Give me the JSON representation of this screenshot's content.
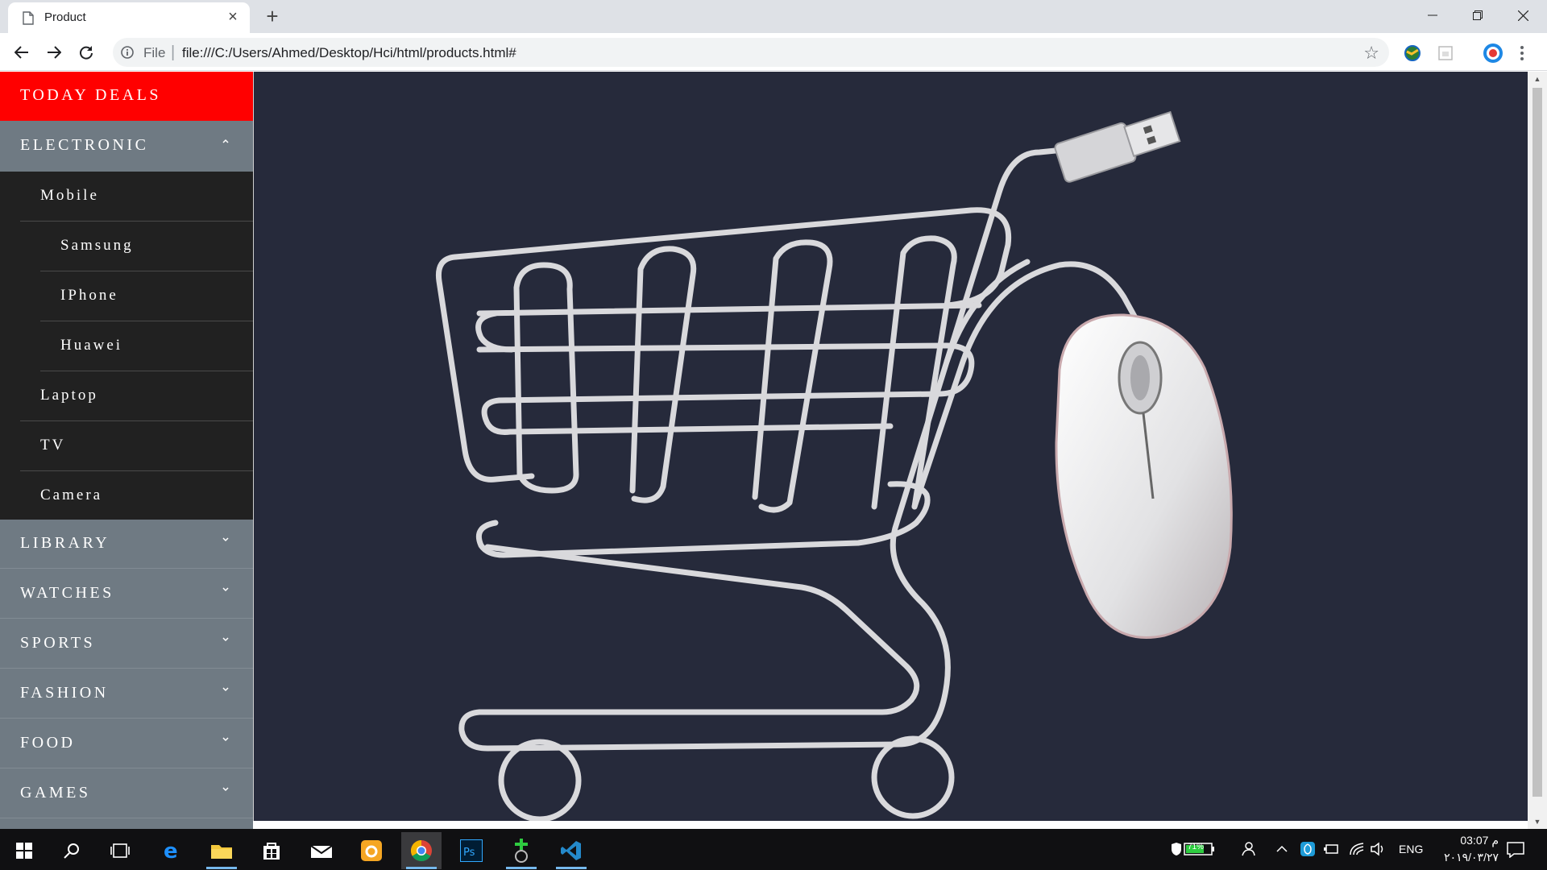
{
  "browser": {
    "tab_title": "Product",
    "scheme": "File",
    "url": "file:///C:/Users/Ahmed/Desktop/Hci/html/products.html#"
  },
  "sidebar": {
    "deals": "TODAY DEALS",
    "electronic": "ELECTRONIC",
    "sub": {
      "mobile": "Mobile",
      "samsung": "Samsung",
      "iphone": "IPhone",
      "huawei": "Huawei",
      "laptop": "Laptop",
      "tv": "TV",
      "camera": "Camera"
    },
    "categories": [
      "LIBRARY",
      "WATCHES",
      "SPORTS",
      "FASHION",
      "FOOD",
      "GAMES"
    ]
  },
  "colors": {
    "deals_bg": "#ff0000",
    "sidebar_bg": "#6f7a83",
    "submenu_bg": "#212121",
    "hero_bg": "#262a3b"
  },
  "hero_image": "shopping-cart-with-usb-cable-and-mouse",
  "taskbar": {
    "battery": "71%",
    "language": "ENG",
    "time": "03:07 م",
    "date": "٢٠١٩/٠٣/٢٧"
  }
}
